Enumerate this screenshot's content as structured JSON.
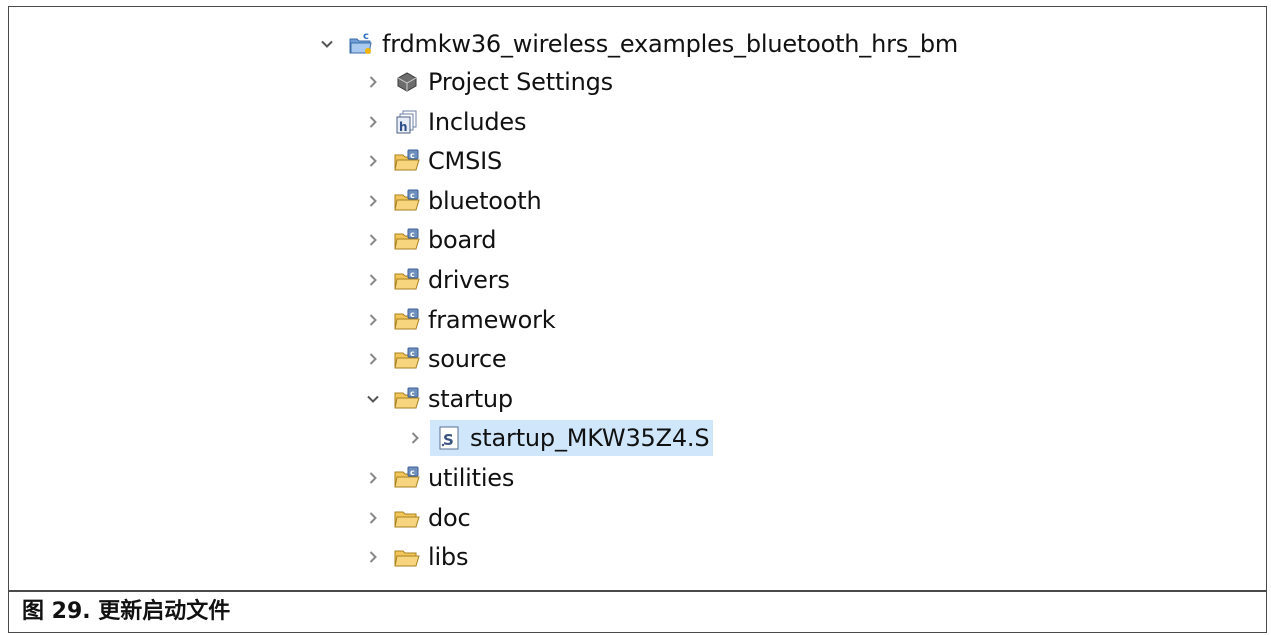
{
  "tree": {
    "root": {
      "label": "frdmkw36_wireless_examples_bluetooth_hrs_bm",
      "expanded": true,
      "icon": "c-project-icon"
    },
    "items": [
      {
        "label": "Project Settings",
        "icon": "settings-chip-icon",
        "expanded": false,
        "depth": 1
      },
      {
        "label": "Includes",
        "icon": "includes-icon",
        "expanded": false,
        "depth": 1
      },
      {
        "label": "CMSIS",
        "icon": "source-folder-icon",
        "expanded": false,
        "depth": 1
      },
      {
        "label": "bluetooth",
        "icon": "source-folder-icon",
        "expanded": false,
        "depth": 1
      },
      {
        "label": "board",
        "icon": "source-folder-icon",
        "expanded": false,
        "depth": 1
      },
      {
        "label": "drivers",
        "icon": "source-folder-icon",
        "expanded": false,
        "depth": 1
      },
      {
        "label": "framework",
        "icon": "source-folder-icon",
        "expanded": false,
        "depth": 1
      },
      {
        "label": "source",
        "icon": "source-folder-icon",
        "expanded": false,
        "depth": 1
      },
      {
        "label": "startup",
        "icon": "source-folder-icon",
        "expanded": true,
        "depth": 1
      },
      {
        "label": "startup_MKW35Z4.S",
        "icon": "asm-file-icon",
        "expanded": false,
        "depth": 2,
        "selected": true
      },
      {
        "label": "utilities",
        "icon": "source-folder-icon",
        "expanded": false,
        "depth": 1
      },
      {
        "label": "doc",
        "icon": "folder-icon",
        "expanded": false,
        "depth": 1
      },
      {
        "label": "libs",
        "icon": "folder-icon",
        "expanded": false,
        "depth": 1
      }
    ]
  },
  "caption": "图 29. 更新启动文件",
  "colors": {
    "selection": "#cfe6fb",
    "folder": "#e8b84a",
    "folder_badge": "#6f8fbf",
    "chevron": "#6e6e6e"
  }
}
